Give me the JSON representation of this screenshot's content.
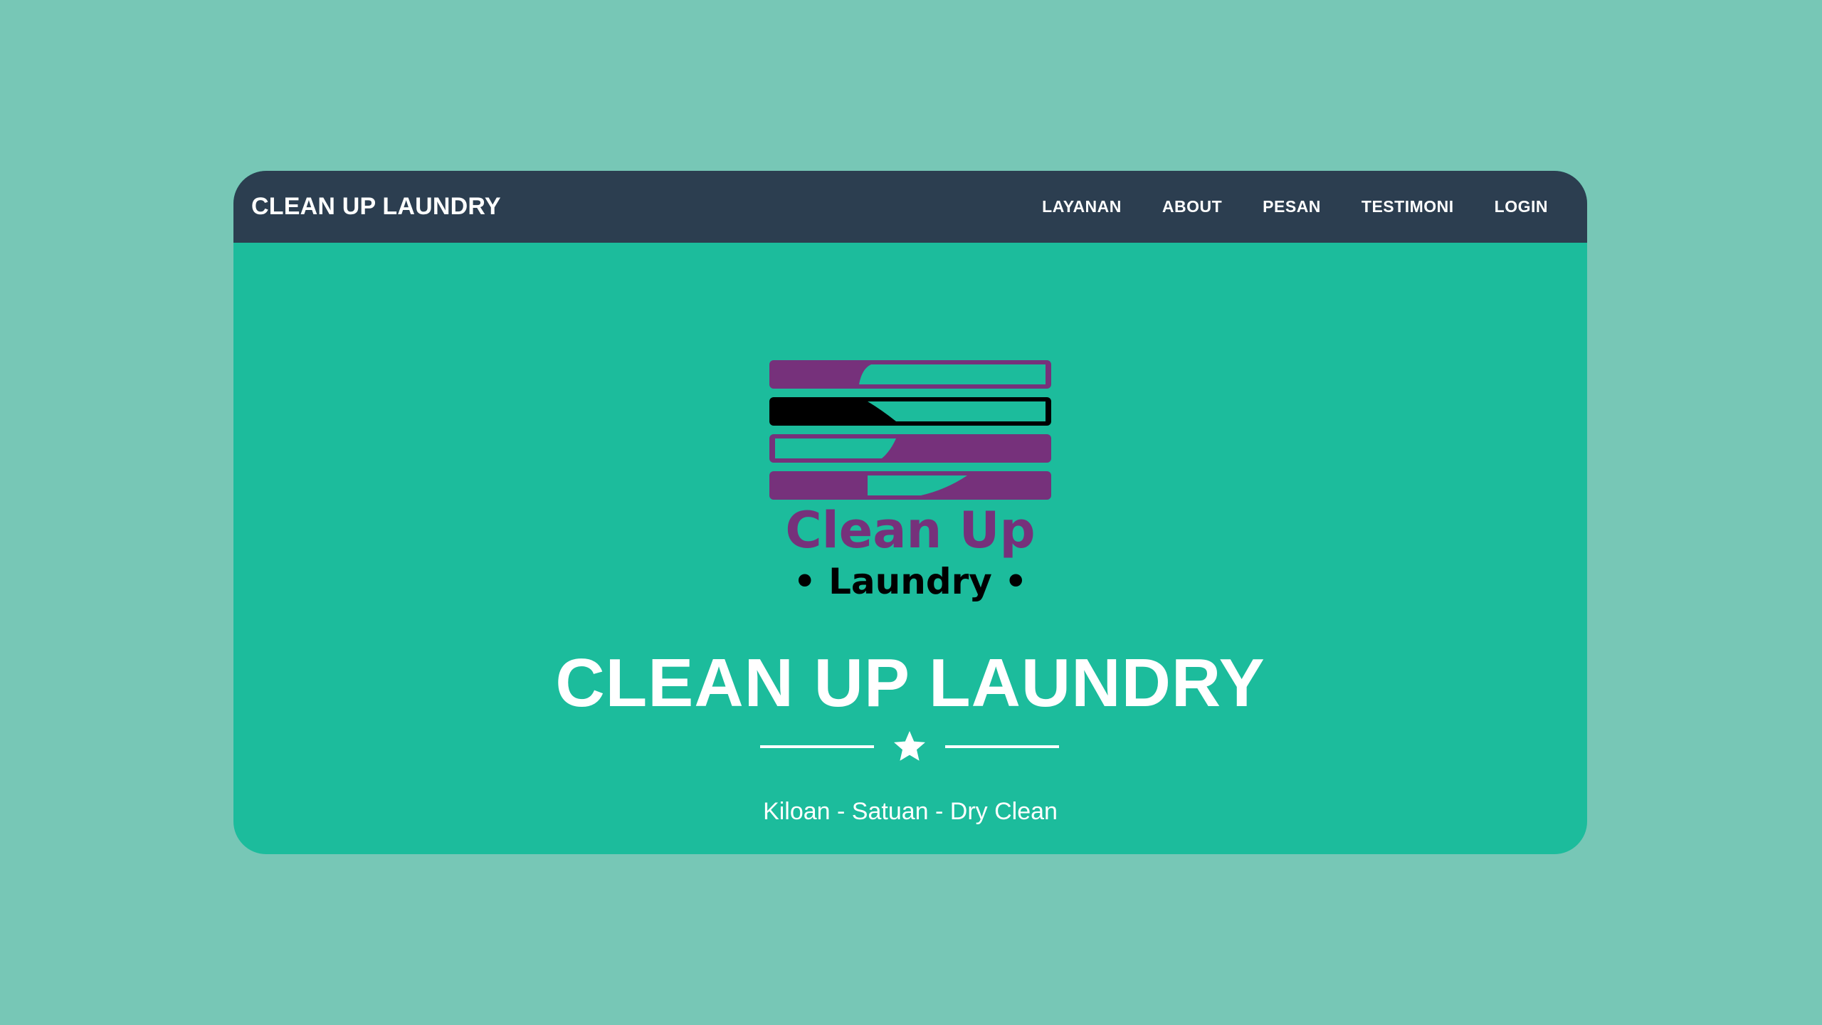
{
  "navbar": {
    "brand": "CLEAN UP LAUNDRY",
    "items": [
      {
        "label": "LAYANAN"
      },
      {
        "label": "ABOUT"
      },
      {
        "label": "PESAN"
      },
      {
        "label": "TESTIMONI"
      },
      {
        "label": "LOGIN"
      }
    ]
  },
  "hero": {
    "logo": {
      "line1": "Clean Up",
      "line2": "• Laundry •",
      "colors": {
        "purple": "#76317b",
        "black": "#000000",
        "teal": "#1cbc9c"
      }
    },
    "title": "CLEAN UP LAUNDRY",
    "divider_icon": "star-icon",
    "subtitle": "Kiloan - Satuan - Dry Clean"
  },
  "colors": {
    "background": "#77c7b6",
    "navbar": "#2c3e50",
    "hero": "#1cbc9c",
    "text": "#ffffff"
  }
}
